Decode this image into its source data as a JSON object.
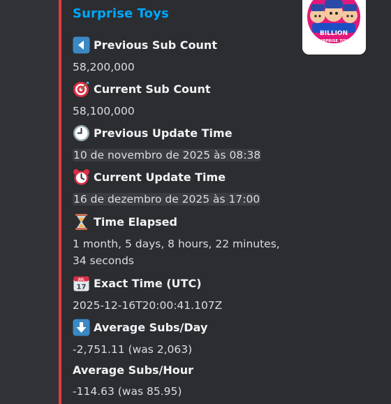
{
  "embed": {
    "title": "Surprise Toys",
    "accent_color": "#e03a3f",
    "thumbnail": {
      "icon": "billion-surprise-toys-logo",
      "text_line1": "BILLION",
      "text_line2": "SURPRISE TOYS"
    }
  },
  "fields": [
    {
      "icon": "back-arrow-icon",
      "name": "Previous Sub Count",
      "value": "58,200,000"
    },
    {
      "icon": "target-icon",
      "name": "Current Sub Count",
      "value": "58,100,000"
    },
    {
      "icon": "clock-icon",
      "name": "Previous Update Time",
      "value": "10 de novembro de 2025 às 08:38"
    },
    {
      "icon": "alarm-clock-icon",
      "name": "Current Update Time",
      "value": "16 de dezembro de 2025 às 17:00"
    },
    {
      "icon": "hourglass-icon",
      "name": "Time Elapsed",
      "value_line1": "1 month, 5 days, 8 hours, 22 minutes,",
      "value_line2": "34 seconds"
    },
    {
      "icon": "calendar-icon",
      "name": "Exact Time (UTC)",
      "value": "2025-12-16T20:00:41.107Z"
    },
    {
      "icon": "down-arrow-icon",
      "name": "Average Subs/Day",
      "value": "-2,751.11 (was 2,063)"
    },
    {
      "name": "Average Subs/Hour",
      "value": "-114.63 (was 85.95)"
    }
  ]
}
